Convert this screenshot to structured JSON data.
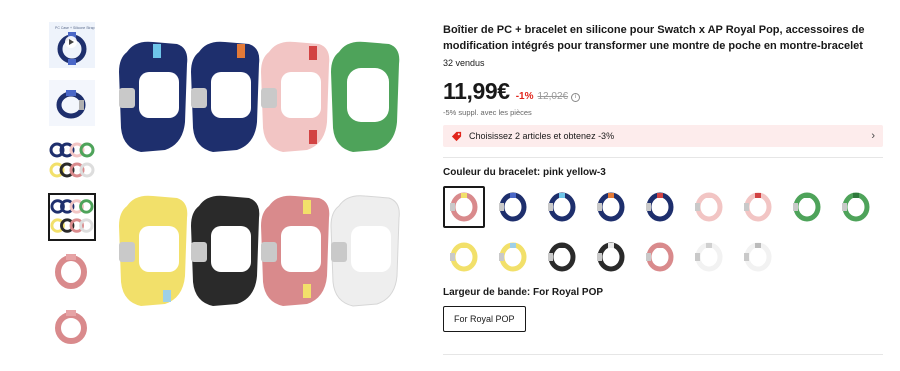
{
  "colors": {
    "navy": "#1e2f6d",
    "navy_dark": "#15224f",
    "pink": "#f2c5c4",
    "pink_deep": "#d98a8c",
    "green": "#4ea35a",
    "yellow": "#f2e06a",
    "black": "#2a2a2a",
    "white": "#f2f2f2",
    "gray": "#c9c9c9",
    "accent_red": "#e1251b"
  },
  "thumbnails": [
    {
      "name": "thumb-video",
      "icon": "play-icon",
      "caption": "PC Case + Silicone Strap"
    },
    {
      "name": "thumb-navy-light",
      "icon": "watch-band-icon"
    },
    {
      "name": "thumb-multicolor-grid",
      "icon": "watch-band-icon"
    },
    {
      "name": "thumb-multicolor-grid-2",
      "icon": "watch-band-icon"
    },
    {
      "name": "thumb-pink",
      "icon": "watch-band-icon"
    },
    {
      "name": "thumb-pink-2",
      "icon": "watch-band-icon"
    }
  ],
  "product": {
    "title": "Boîtier de PC + bracelet en silicone pour Swatch x AP Royal Pop, accessoires de modification intégrés pour transformer une montre de poche en montre-bracelet",
    "sold": "32 vendus",
    "price": "11,99€",
    "discount": "-1%",
    "old_price": "12,02€",
    "extra_off": "-5% suppl. avec les pièces",
    "promo_text": "Choisissez 2 articles et obtenez -3%",
    "promo_chevron": "›",
    "info_icon": "i"
  },
  "color_section": {
    "label": "Couleur du bracelet: pink yellow-3",
    "swatches": [
      {
        "name": "pink-yellow-3",
        "strap": "#d98a8c",
        "accent": "#f2e06a",
        "selected": true
      },
      {
        "name": "navy-1",
        "strap": "#1e2f6d",
        "accent": "#4a67c7"
      },
      {
        "name": "navy-2",
        "strap": "#1e2f6d",
        "accent": "#6ec5e9"
      },
      {
        "name": "navy-3",
        "strap": "#1e2f6d",
        "accent": "#e37a38"
      },
      {
        "name": "navy-4",
        "strap": "#1e2f6d",
        "accent": "#d24343"
      },
      {
        "name": "pink-1",
        "strap": "#f2c5c4",
        "accent": "#f2c5c4"
      },
      {
        "name": "pink-2",
        "strap": "#f2c5c4",
        "accent": "#d24343"
      },
      {
        "name": "green-1",
        "strap": "#4ea35a",
        "accent": "#4ea35a"
      },
      {
        "name": "green-2",
        "strap": "#4ea35a",
        "accent": "#2f7a3c"
      },
      {
        "name": "yellow-1",
        "strap": "#f2e06a",
        "accent": "#f2e06a"
      },
      {
        "name": "yellow-2",
        "strap": "#f2e06a",
        "accent": "#9fd0e8"
      },
      {
        "name": "black-1",
        "strap": "#2a2a2a",
        "accent": "#2a2a2a"
      },
      {
        "name": "black-2",
        "strap": "#2a2a2a",
        "accent": "#e8e8e8"
      },
      {
        "name": "pink-3",
        "strap": "#d98a8c",
        "accent": "#d98a8c"
      },
      {
        "name": "white-1",
        "strap": "#f2f2f2",
        "accent": "#d0d0d0"
      },
      {
        "name": "white-2",
        "strap": "#f2f2f2",
        "accent": "#bbbbbb"
      }
    ]
  },
  "band_section": {
    "label": "Largeur de bande: For Royal POP",
    "option": "For Royal POP"
  }
}
